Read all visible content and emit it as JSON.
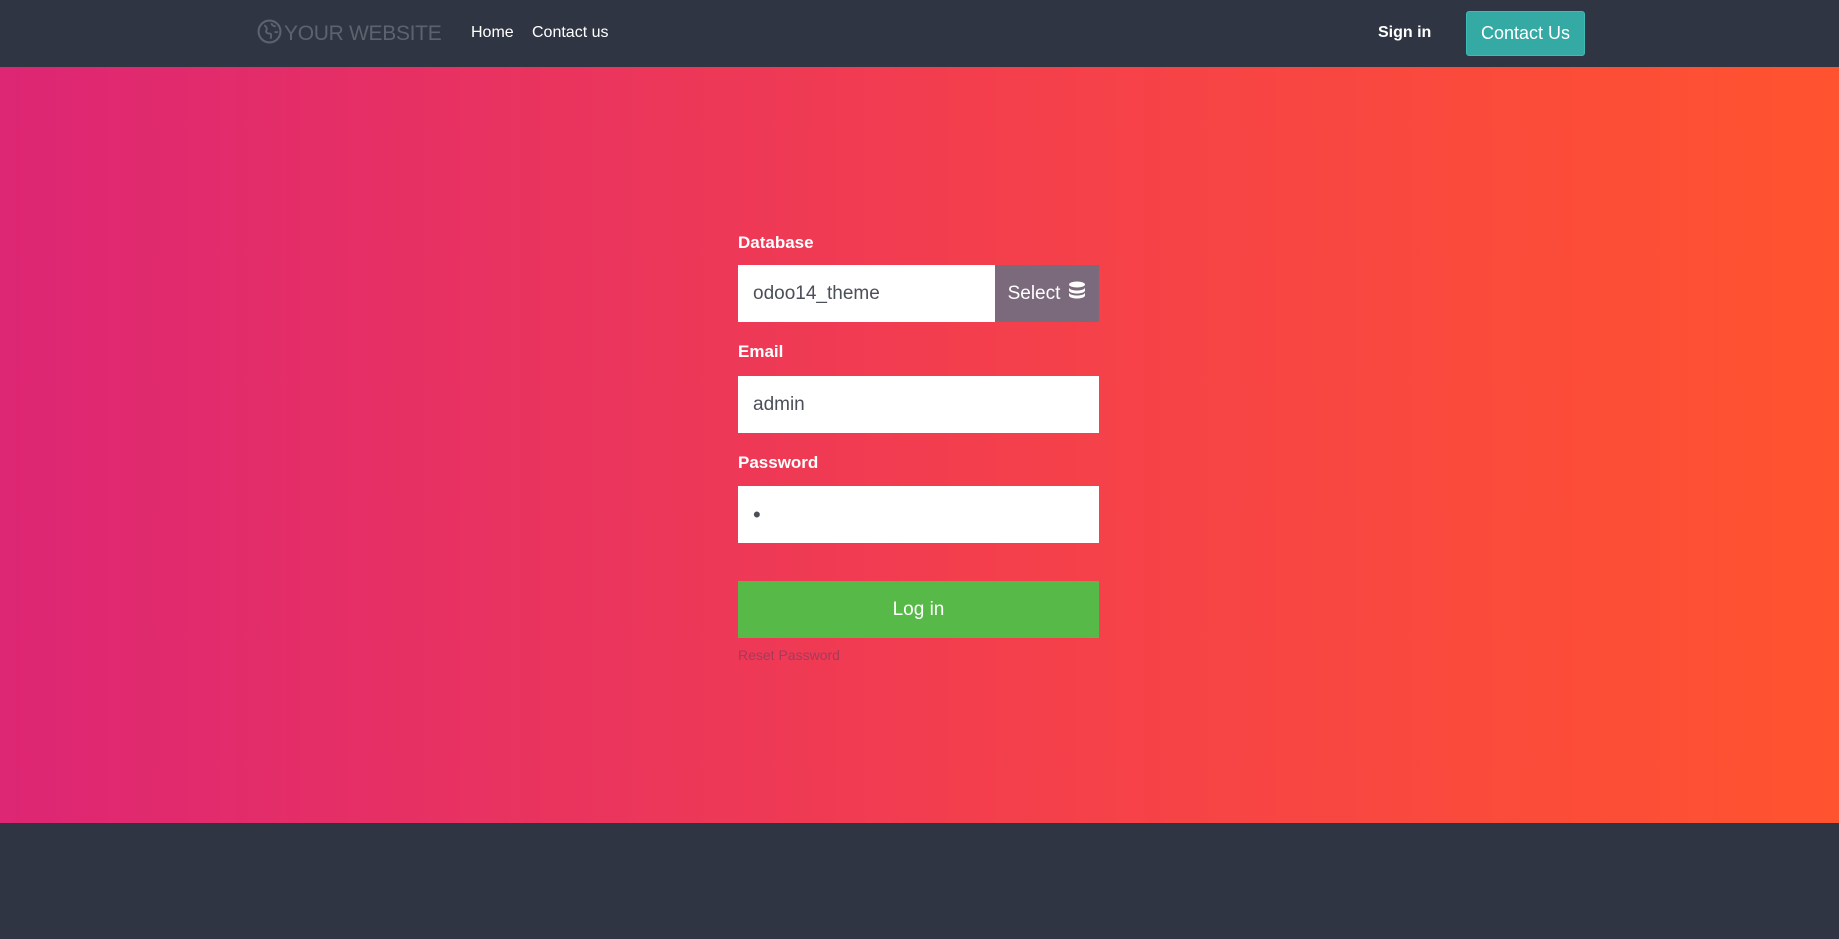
{
  "navbar": {
    "logo_text": "YOUR WEBSITE",
    "logo_icon": "globe-icon",
    "links": [
      {
        "label": "Home"
      },
      {
        "label": "Contact us"
      }
    ],
    "sign_in_label": "Sign in",
    "contact_button_label": "Contact Us",
    "contact_button_color": "#35a9a3"
  },
  "hero": {
    "gradient_start": "#dd2674",
    "gradient_end": "#ff532f"
  },
  "login_form": {
    "database": {
      "label": "Database",
      "value": "odoo14_theme",
      "select_label": "Select",
      "select_icon": "database-icon"
    },
    "email": {
      "label": "Email",
      "value": "admin"
    },
    "password": {
      "label": "Password",
      "value": "•"
    },
    "login_button_label": "Log in",
    "login_button_color": "#57ba48",
    "reset_password_label": "Reset Password"
  }
}
